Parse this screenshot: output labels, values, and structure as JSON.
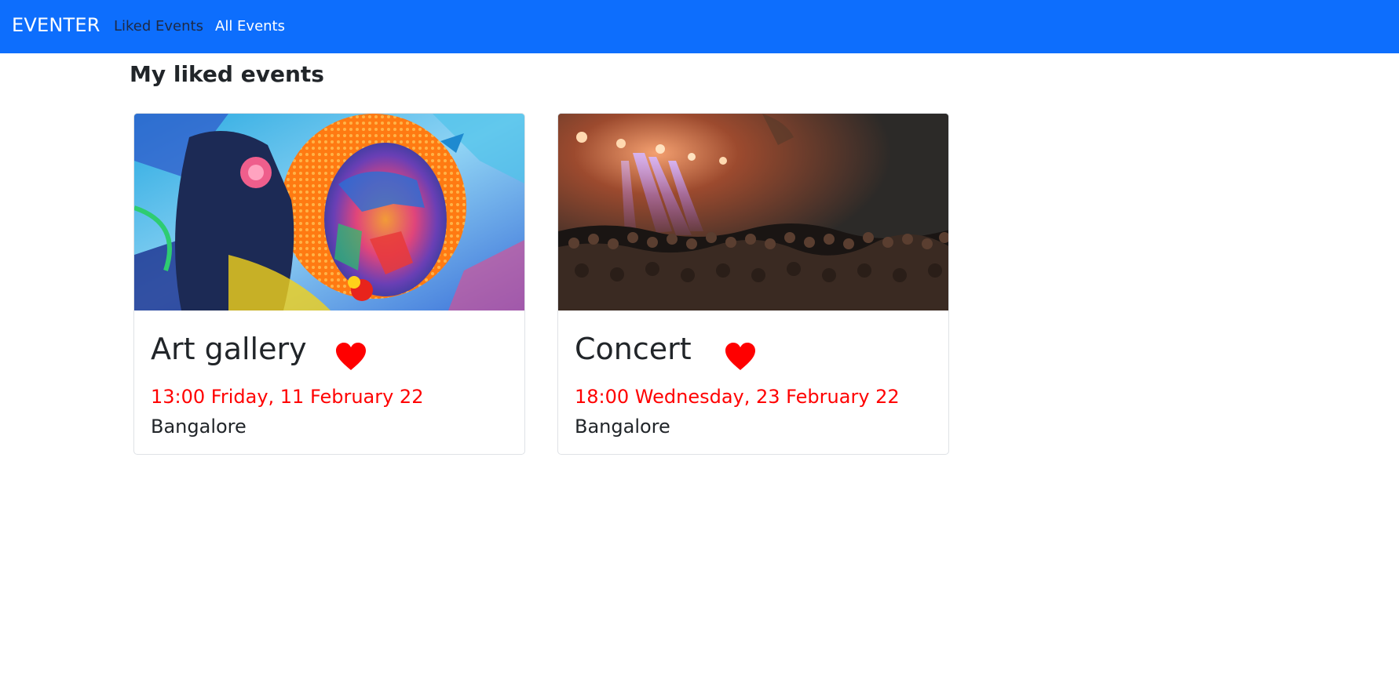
{
  "navbar": {
    "brand": "EVENTER",
    "links": [
      {
        "label": "Liked Events"
      },
      {
        "label": "All Events"
      }
    ],
    "background_color": "#0d6efd"
  },
  "page": {
    "title": "My liked events"
  },
  "events": [
    {
      "title": "Art gallery",
      "datetime": "13:00 Friday, 11 February 22",
      "location": "Bangalore",
      "liked": true,
      "image": "colorful-portrait-painting"
    },
    {
      "title": "Concert",
      "datetime": "18:00 Wednesday, 23 February 22",
      "location": "Bangalore",
      "liked": true,
      "image": "concert-crowd-stage-lights"
    }
  ],
  "colors": {
    "date_text": "#ff0000",
    "heart": "#ff0000"
  }
}
